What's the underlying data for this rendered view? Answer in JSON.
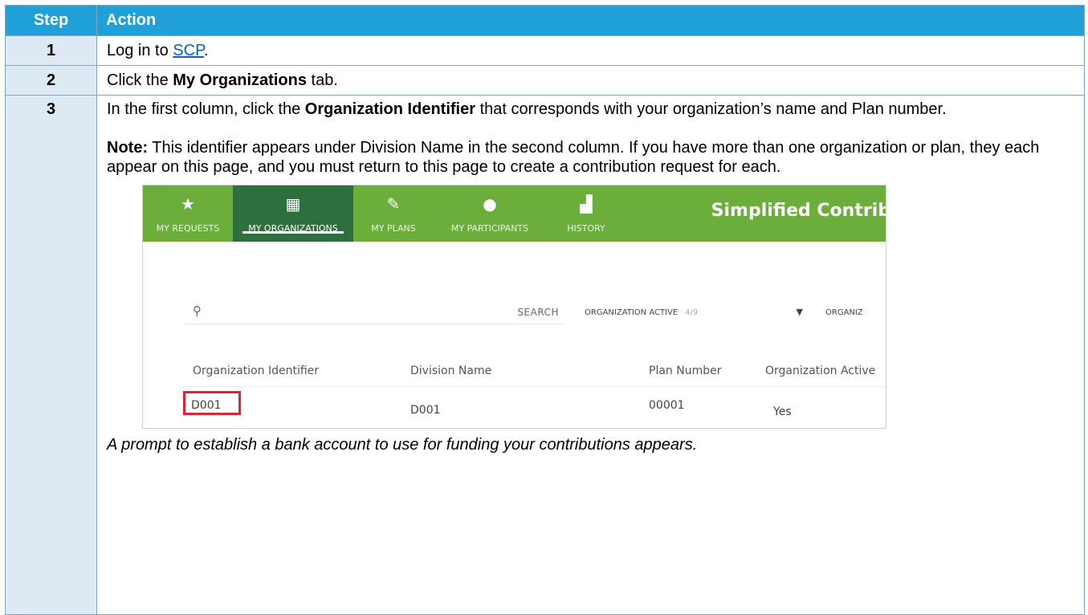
{
  "table": {
    "header": {
      "step": "Step",
      "action": "Action"
    },
    "rows": [
      {
        "step": "1",
        "pre": "Log in to ",
        "link": "SCP",
        "post": "."
      },
      {
        "step": "2",
        "pre": "Click the ",
        "bold": "My Organizations",
        "post": " tab."
      },
      {
        "step": "3",
        "pre": "In the first column, click the ",
        "bold": "Organization Identifier",
        "post": " that corresponds with your organization’s name and Plan number.",
        "note_label": "Note:",
        "note_text": " This identifier appears under Division Name in the second column. If you have more than one organization or plan, they each appear on this page, and you must return to this page to create a contribution request for each.",
        "caption": "A prompt to establish a bank account to use for funding your contributions appears."
      }
    ]
  },
  "screenshot": {
    "nav": [
      {
        "label": "MY REQUESTS",
        "icon": "star-icon",
        "glyph": "★"
      },
      {
        "label": "MY ORGANIZATIONS",
        "icon": "building-icon",
        "glyph": "▦"
      },
      {
        "label": "MY PLANS",
        "icon": "pencil-icon",
        "glyph": "✎"
      },
      {
        "label": "MY PARTICIPANTS",
        "icon": "person-icon",
        "glyph": "●"
      },
      {
        "label": "HISTORY",
        "icon": "history-icon",
        "glyph": "▟"
      }
    ],
    "active_tab": "MY ORGANIZATIONS",
    "brand": "Simplified Contrib",
    "search": {
      "placeholder": "",
      "button": "SEARCH"
    },
    "filter1": {
      "label": "ORGANIZATION ACTIVE",
      "value": "4/9"
    },
    "filter2": {
      "label": "ORGANIZ"
    },
    "columns": [
      "Organization Identifier",
      "Division Name",
      "Plan Number",
      "Organization Active"
    ],
    "row": [
      "D001",
      "D001",
      "00001",
      "Yes"
    ],
    "colors": {
      "green": "#6cae3b",
      "dark_green": "#2e6f3e",
      "highlight": "#d9263a",
      "header_blue": "#1fa0d8",
      "step_col": "#dde9f3"
    }
  }
}
